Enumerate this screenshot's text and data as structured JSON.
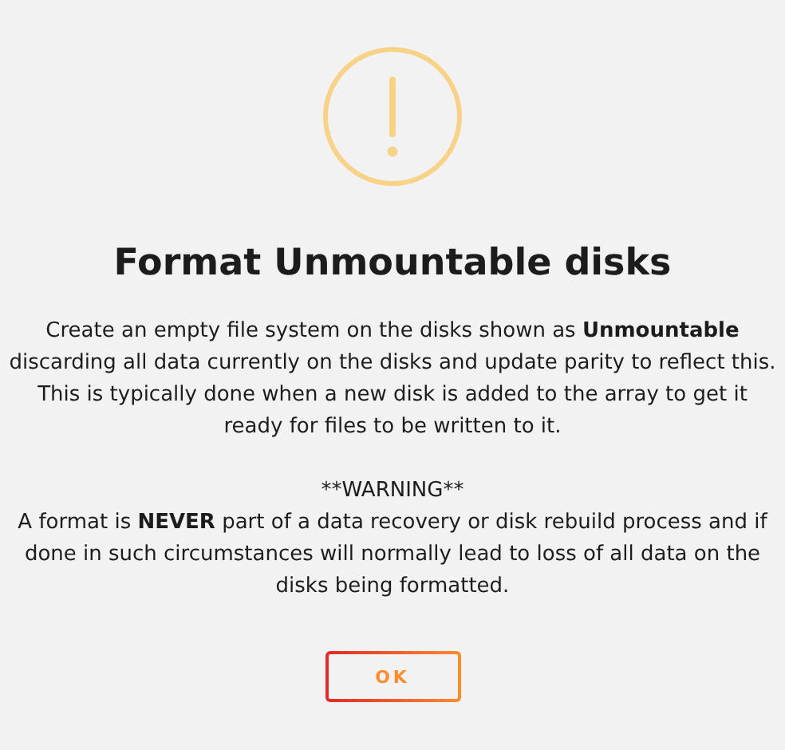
{
  "dialog": {
    "title": "Format Unmountable disks",
    "description": "Create an empty file system on the disks shown as **Unmountable** discarding all data currently on the disks and update parity to reflect this. This is typically done when a new disk is added to the array to get it ready for files to be written to it.",
    "warning_heading": "**WARNING**",
    "warning_text": "A format is **NEVER** part of a data recovery or disk rebuild process and if done in such circumstances will normally lead to loss of all data on the disks being formatted.",
    "buttons": [
      "OK"
    ]
  }
}
